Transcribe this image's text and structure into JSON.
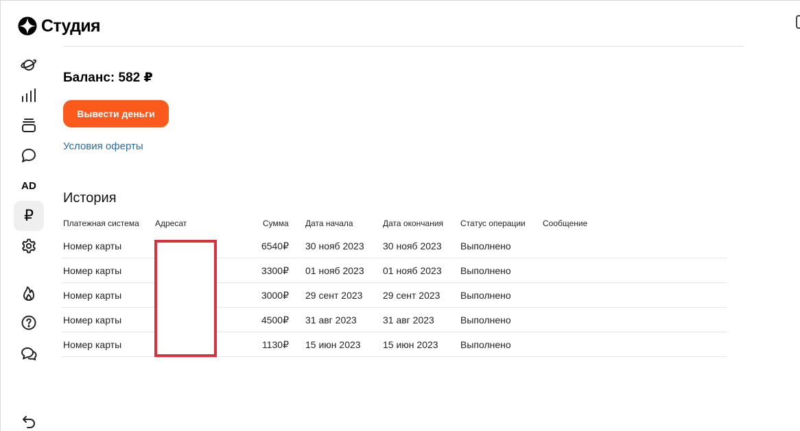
{
  "app": {
    "logo_text": "Студия"
  },
  "sidebar": {
    "items": [
      {
        "icon": "planet-icon"
      },
      {
        "icon": "bar-chart-icon"
      },
      {
        "icon": "layers-icon"
      },
      {
        "icon": "chat-bubble-icon"
      },
      {
        "icon": "ad-icon",
        "label": "AD"
      },
      {
        "icon": "ruble-icon",
        "label": "₽",
        "active": true
      },
      {
        "icon": "gear-icon"
      },
      {
        "icon": "flame-icon"
      },
      {
        "icon": "help-icon"
      },
      {
        "icon": "chats-icon"
      },
      {
        "icon": "back-arrow-icon"
      }
    ]
  },
  "balance": {
    "text": "Баланс: 582 ₽"
  },
  "actions": {
    "withdraw_label": "Вывести деньги",
    "offer_link": "Условия оферты"
  },
  "history": {
    "title": "История",
    "columns": [
      "Платежная система",
      "Адресат",
      "Сумма",
      "Дата начала",
      "Дата окончания",
      "Статус операции",
      "Сообщение"
    ],
    "rows": [
      {
        "system": "Номер карты",
        "recipient": "",
        "amount": "6540₽",
        "start": "30 нояб 2023",
        "end": "30 нояб 2023",
        "status": "Выполнено",
        "message": ""
      },
      {
        "system": "Номер карты",
        "recipient": "",
        "amount": "3300₽",
        "start": "01 нояб 2023",
        "end": "01 нояб 2023",
        "status": "Выполнено",
        "message": ""
      },
      {
        "system": "Номер карты",
        "recipient": "",
        "amount": "3000₽",
        "start": "29 сент 2023",
        "end": "29 сент 2023",
        "status": "Выполнено",
        "message": ""
      },
      {
        "system": "Номер карты",
        "recipient": "",
        "amount": "4500₽",
        "start": "31 авг 2023",
        "end": "31 авг 2023",
        "status": "Выполнено",
        "message": ""
      },
      {
        "system": "Номер карты",
        "recipient": "",
        "amount": "1130₽",
        "start": "15 июн 2023",
        "end": "15 июн 2023",
        "status": "Выполнено",
        "message": ""
      }
    ]
  },
  "colors": {
    "accent": "#fc5a1c",
    "link": "#2b6a9d",
    "redaction": "#d9303a",
    "active_nav_bg": "#efefef"
  }
}
